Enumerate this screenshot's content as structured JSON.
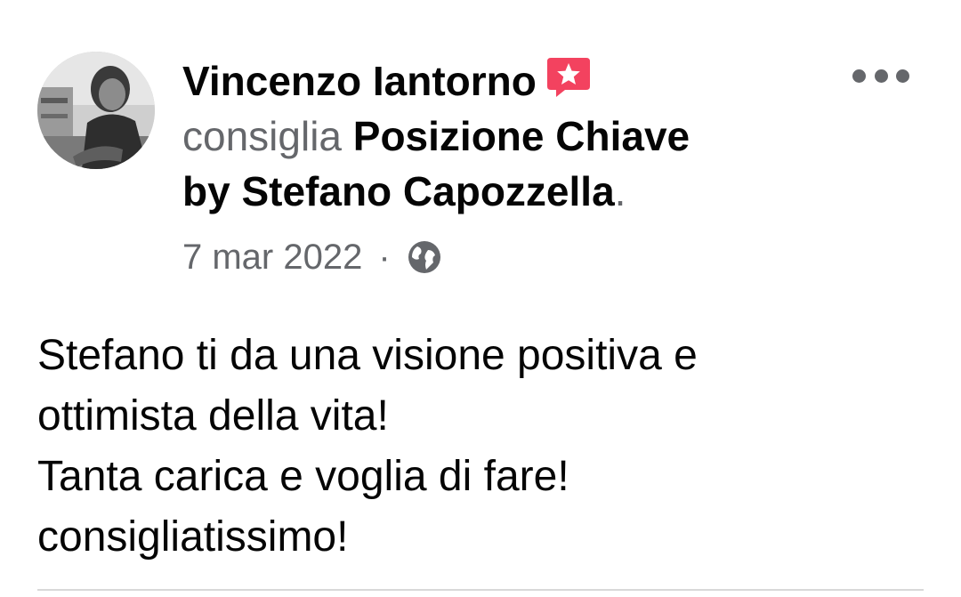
{
  "post": {
    "author": "Vincenzo Iantorno",
    "verb": "consiglia",
    "page_line1": "Posizione Chiave",
    "page_line2": "by Stefano Capozzella",
    "period": ".",
    "date": "7 mar 2022",
    "separator": "·",
    "audience_icon": "globe-icon",
    "badge_icon": "recommend-star-icon",
    "more_icon": "more-options-icon",
    "body_lines": [
      "Stefano ti da una visione positiva e",
      "ottimista della vita!",
      "Tanta carica e voglia di fare!",
      "consigliatissimo!"
    ]
  },
  "colors": {
    "badge": "#f3425f",
    "secondary_text": "#65676b",
    "primary_text": "#050505"
  }
}
